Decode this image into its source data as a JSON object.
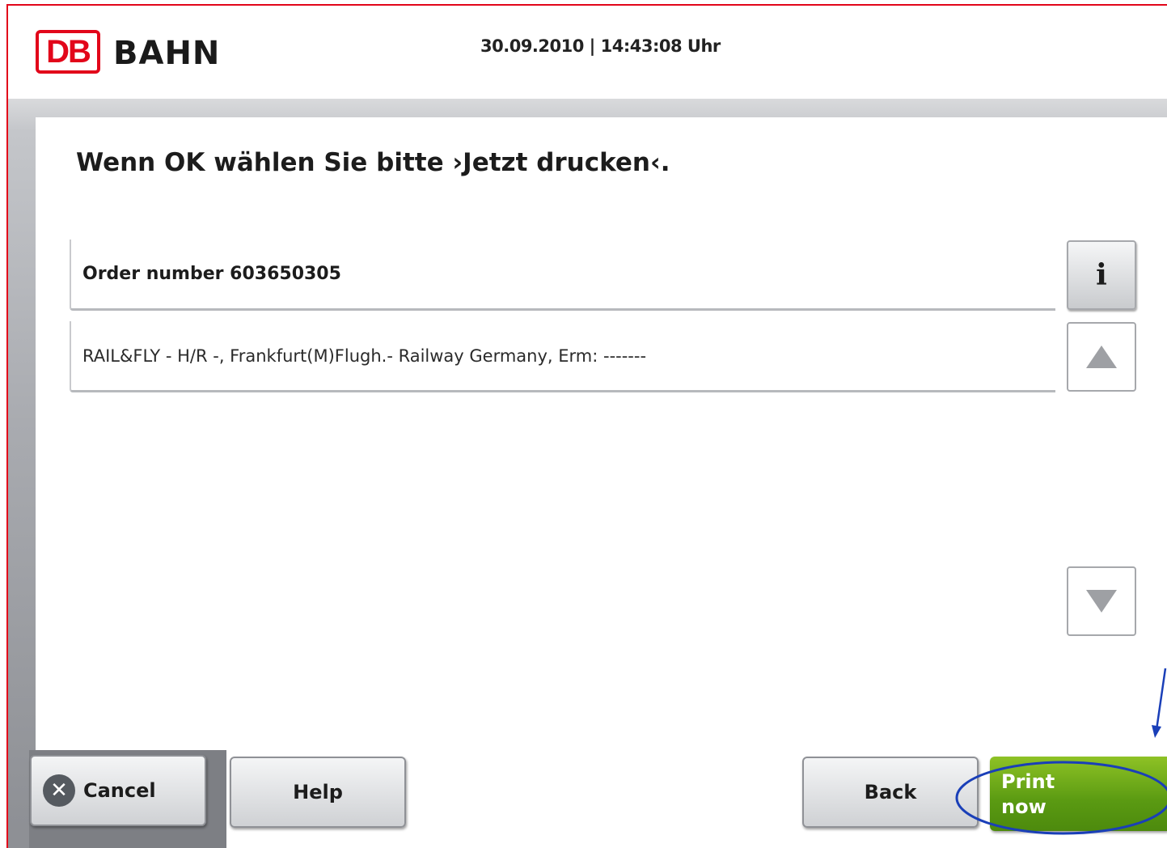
{
  "header": {
    "logo_text": "DB",
    "brand_text": "BAHN",
    "datetime": "30.09.2010 | 14:43:08 Uhr"
  },
  "main": {
    "title": "Wenn OK wählen Sie bitte ›Jetzt drucken‹.",
    "rows": [
      {
        "label": "Order number 603650305"
      },
      {
        "label": "RAIL&FLY - H/R -, Frankfurt(M)Flugh.- Railway Germany, Erm: -------"
      }
    ],
    "info_button_glyph": "i"
  },
  "footer": {
    "cancel_label": "Cancel",
    "cancel_glyph": "✕",
    "help_label": "Help",
    "back_label": "Back",
    "print_label_line1": "Print",
    "print_label_line2": "now"
  },
  "colors": {
    "brand_red": "#e2061a",
    "print_green": "#6aaa16",
    "annotation_blue": "#1a3fb8"
  },
  "icons": [
    "info-icon",
    "arrow-up-icon",
    "arrow-down-icon",
    "close-circle-icon"
  ]
}
